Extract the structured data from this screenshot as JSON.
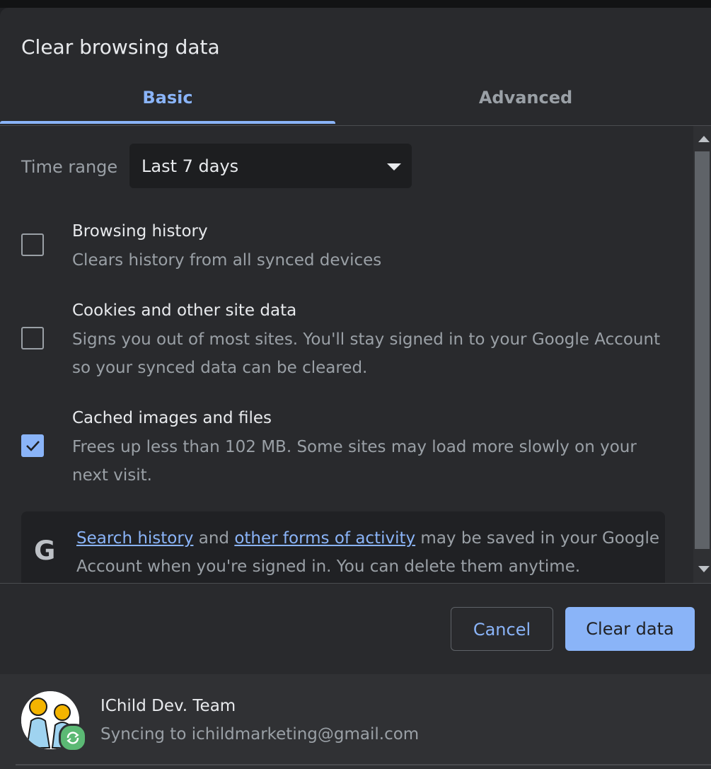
{
  "dialog": {
    "title": "Clear browsing data"
  },
  "tabs": [
    {
      "label": "Basic",
      "selected": true
    },
    {
      "label": "Advanced",
      "selected": false
    }
  ],
  "time_range": {
    "label": "Time range",
    "value": "Last 7 days"
  },
  "options": [
    {
      "title": "Browsing history",
      "description": "Clears history from all synced devices",
      "checked": false
    },
    {
      "title": "Cookies and other site data",
      "description": "Signs you out of most sites. You'll stay signed in to your Google Account so your synced data can be cleared.",
      "checked": false
    },
    {
      "title": "Cached images and files",
      "description": "Frees up less than 102 MB. Some sites may load more slowly on your next visit.",
      "checked": true
    }
  ],
  "info": {
    "icon": "google-g-icon",
    "link1": "Search history",
    "and": "and",
    "link2": "other forms of activity",
    "text": "may be saved in your Google Account when you're signed in. You can delete them anytime."
  },
  "buttons": {
    "cancel": "Cancel",
    "clear": "Clear data"
  },
  "account": {
    "name": "IChild Dev. Team",
    "sync_text": "Syncing to ichildmarketing@gmail.com"
  },
  "colors": {
    "accent": "#8ab4f8",
    "background": "#292a2d",
    "secondary_text": "#9aa0a6"
  }
}
